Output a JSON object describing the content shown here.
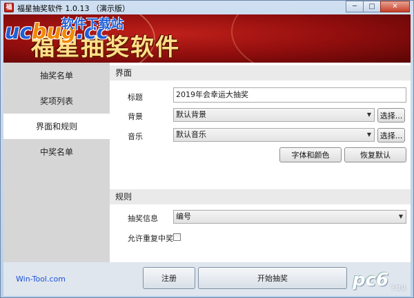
{
  "window": {
    "title": "福星抽奖软件 1.0.13 （演示版）",
    "app_icon_glyph": "福",
    "controls": {
      "minimize": "─",
      "maximize": "□",
      "close": "✕"
    }
  },
  "banner": {
    "title": "福星抽奖软件",
    "watermark_main": "uc",
    "watermark_bug": "bug",
    "watermark_suffix": ".cc",
    "watermark_sub": "软件下载站"
  },
  "sidebar": {
    "items": [
      {
        "label": "抽奖名单",
        "active": false
      },
      {
        "label": "奖项列表",
        "active": false
      },
      {
        "label": "界面和规则",
        "active": true
      },
      {
        "label": "中奖名单",
        "active": false
      }
    ]
  },
  "interface": {
    "header": "界面",
    "title_label": "标题",
    "title_value": "2019年会幸运大抽奖",
    "background_label": "背景",
    "background_value": "默认背景",
    "background_choose": "选择...",
    "music_label": "音乐",
    "music_value": "默认音乐",
    "music_choose": "选择...",
    "font_color_button": "字体和颜色",
    "restore_default_button": "恢复默认"
  },
  "rules": {
    "header": "规则",
    "info_label": "抽奖信息",
    "info_value": "编号",
    "allow_repeat_label": "允许重复中奖",
    "allow_repeat_checked": false
  },
  "footer": {
    "link": "Win-Tool.com",
    "register_button": "注册",
    "start_button": "开始抽奖",
    "logo_text": "pc6",
    "logo_sub": "下载站"
  },
  "colors": {
    "banner_red": "#8e0d0d",
    "banner_title": "#ffe08a",
    "link_blue": "#1b4fd8"
  }
}
